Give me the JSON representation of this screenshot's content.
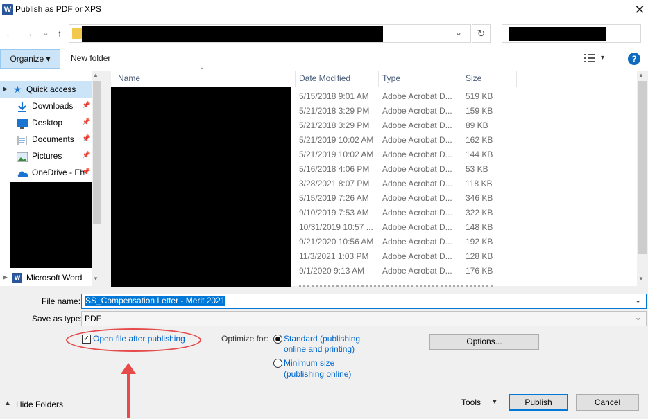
{
  "window": {
    "title": "Publish as PDF or XPS",
    "app_icon": "word-icon",
    "close_glyph": "✕"
  },
  "nav": {
    "back": "←",
    "forward": "→",
    "recent": "⌄",
    "up": "↑",
    "refresh": "↻",
    "dropdown": "⌄"
  },
  "toolbar": {
    "organize_label": "Organize ▾",
    "new_folder_label": "New folder",
    "view_caret": "▾",
    "help_glyph": "?"
  },
  "sidebar": {
    "quick_access": "Quick access",
    "items": [
      {
        "label": "Downloads",
        "icon": "download-arrow-icon",
        "pinned": true
      },
      {
        "label": "Desktop",
        "icon": "desktop-icon",
        "pinned": true
      },
      {
        "label": "Documents",
        "icon": "documents-icon",
        "pinned": true
      },
      {
        "label": "Pictures",
        "icon": "pictures-icon",
        "pinned": true
      },
      {
        "label": "OneDrive - Eh",
        "icon": "onedrive-cloud-icon",
        "pinned": true
      }
    ],
    "microsoft_word": "Microsoft Word",
    "pin_glyph": "📌"
  },
  "file_list": {
    "columns": [
      "Name",
      "Date Modified",
      "Type",
      "Size"
    ],
    "rows": [
      {
        "date": "5/15/2018 9:01 AM",
        "type": "Adobe Acrobat D...",
        "size": "519 KB"
      },
      {
        "date": "5/21/2018 3:29 PM",
        "type": "Adobe Acrobat D...",
        "size": "159 KB"
      },
      {
        "date": "5/21/2018 3:29 PM",
        "type": "Adobe Acrobat D...",
        "size": "89 KB"
      },
      {
        "date": "5/21/2019 10:02 AM",
        "type": "Adobe Acrobat D...",
        "size": "162 KB"
      },
      {
        "date": "5/21/2019 10:02 AM",
        "type": "Adobe Acrobat D...",
        "size": "144 KB"
      },
      {
        "date": "5/16/2018 4:06 PM",
        "type": "Adobe Acrobat D...",
        "size": "53 KB"
      },
      {
        "date": "3/28/2021 8:07 PM",
        "type": "Adobe Acrobat D...",
        "size": "118 KB"
      },
      {
        "date": "5/15/2019 7:26 AM",
        "type": "Adobe Acrobat D...",
        "size": "346 KB"
      },
      {
        "date": "9/10/2019 7:53 AM",
        "type": "Adobe Acrobat D...",
        "size": "322 KB"
      },
      {
        "date": "10/31/2019 10:57 ...",
        "type": "Adobe Acrobat D...",
        "size": "148 KB"
      },
      {
        "date": "9/21/2020 10:56 AM",
        "type": "Adobe Acrobat D...",
        "size": "192 KB"
      },
      {
        "date": "11/3/2021 1:03 PM",
        "type": "Adobe Acrobat D...",
        "size": "128 KB"
      },
      {
        "date": "9/1/2020 9:13 AM",
        "type": "Adobe Acrobat D...",
        "size": "176 KB"
      }
    ]
  },
  "form": {
    "file_name_label": "File name:",
    "file_name_value": "SS_Compensation Letter - Merit 2021",
    "save_as_type_label": "Save as type:",
    "save_as_type_value": "PDF",
    "open_after_label": "Open file after publishing",
    "open_after_checked": true,
    "optimize_label": "Optimize for:",
    "standard_line1": "Standard (publishing",
    "standard_line2": "online and printing)",
    "minimum_line1": "Minimum size",
    "minimum_line2": "(publishing online)",
    "options_label": "Options..."
  },
  "footer": {
    "hide_folders": "Hide Folders",
    "tools": "Tools",
    "publish": "Publish",
    "cancel": "Cancel"
  },
  "annotation": {
    "color": "#e64a4a"
  }
}
